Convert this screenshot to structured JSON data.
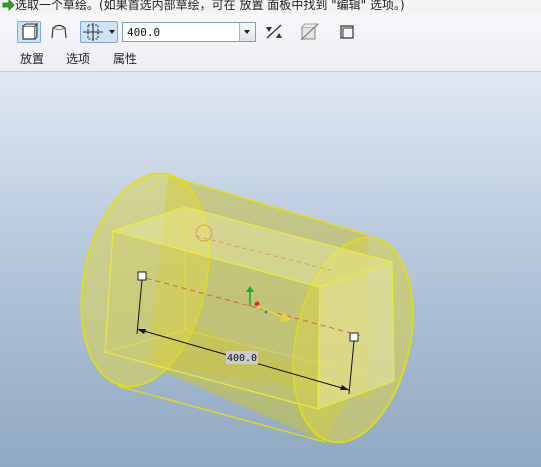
{
  "status": {
    "message": "选取一个草绘。(如果首选内部草绘，可在 放置 面板中找到 \"编辑\" 选项。)",
    "icon": "green-arrow-icon"
  },
  "toolbar": {
    "solid_button_icon": "solid-extrude-icon",
    "surface_button_icon": "surface-extrude-icon",
    "depth_option_icon": "blind-depth-icon",
    "depth_value": "400.0",
    "flip_direction_icon": "flip-direction-icon",
    "remove_material_icon": "remove-material-icon",
    "thicken_icon": "thicken-sketch-icon"
  },
  "tabs": [
    {
      "label": "放置"
    },
    {
      "label": "选项"
    },
    {
      "label": "属性"
    }
  ],
  "model": {
    "dimension_label": "400.0"
  },
  "colors": {
    "preview_fill": "#d8d24a",
    "preview_edge": "#e6e000",
    "viewport_top": "#e0e9f3",
    "viewport_bottom": "#90a8c2",
    "active_button": "#cfe3f7"
  }
}
